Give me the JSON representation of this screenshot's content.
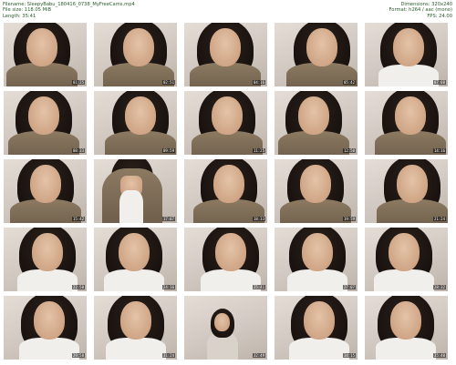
{
  "meta": {
    "filename_label": "Filename:",
    "filename": "SleepyBabu_180416_0738_MyFreeCams.mp4",
    "filesize_label": "File size:",
    "filesize": "118.05 MiB",
    "length_label": "Length:",
    "length": "35:41",
    "dimensions_label": "Dimensions:",
    "dimensions": "320x240",
    "format_label": "Format:",
    "format": "h264 / aac (mono)",
    "fps_label": "FPS:",
    "fps": "24.00"
  },
  "thumbnails": [
    {
      "time": "01:25",
      "variant": "sweater"
    },
    {
      "time": "02:51",
      "variant": "sweater"
    },
    {
      "time": "04:16",
      "variant": "sweater"
    },
    {
      "time": "05:42",
      "variant": "sweater"
    },
    {
      "time": "07:08",
      "variant": "shirt"
    },
    {
      "time": "08:33",
      "variant": "sweater"
    },
    {
      "time": "09:59",
      "variant": "sweater"
    },
    {
      "time": "11:25",
      "variant": "sweater"
    },
    {
      "time": "12:50",
      "variant": "sweater"
    },
    {
      "time": "14:16",
      "variant": "sweater"
    },
    {
      "time": "15:42",
      "variant": "sweater"
    },
    {
      "time": "17:07",
      "variant": "body"
    },
    {
      "time": "18:33",
      "variant": "sweater"
    },
    {
      "time": "19:59",
      "variant": "sweater"
    },
    {
      "time": "21:24",
      "variant": "sweater"
    },
    {
      "time": "22:50",
      "variant": "shirt"
    },
    {
      "time": "24:16",
      "variant": "shirt"
    },
    {
      "time": "25:41",
      "variant": "shirt"
    },
    {
      "time": "27:07",
      "variant": "shirt"
    },
    {
      "time": "28:32",
      "variant": "shirt"
    },
    {
      "time": "29:58",
      "variant": "shirt"
    },
    {
      "time": "31:24",
      "variant": "shirt"
    },
    {
      "time": "32:49",
      "variant": "far"
    },
    {
      "time": "34:15",
      "variant": "shirt"
    },
    {
      "time": "35:40",
      "variant": "shirt"
    }
  ]
}
